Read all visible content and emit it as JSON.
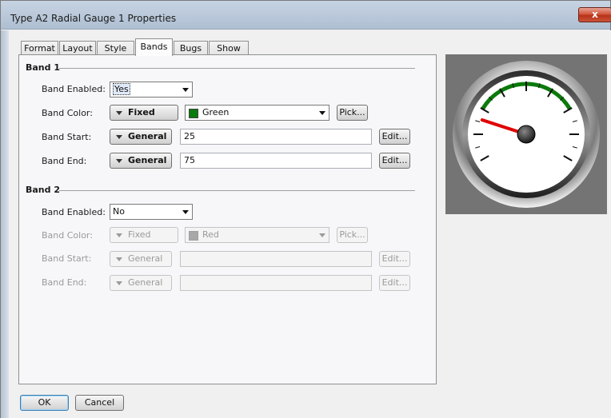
{
  "window": {
    "title": "Type A2 Radial Gauge 1 Properties",
    "close_glyph": "x"
  },
  "tabs": [
    {
      "label": "Format"
    },
    {
      "label": "Layout"
    },
    {
      "label": "Style"
    },
    {
      "label": "Bands",
      "active": true
    },
    {
      "label": "Bugs"
    },
    {
      "label": "Show"
    }
  ],
  "band1": {
    "header": "Band 1",
    "enabled_label": "Band Enabled:",
    "enabled_value": "Yes",
    "color_label": "Band Color:",
    "color_mode": "Fixed",
    "color_value": "Green",
    "color_swatch": "#0a7a0a",
    "pick_label": "Pick...",
    "start_label": "Band Start:",
    "start_mode": "General",
    "start_value": "25",
    "end_label": "Band End:",
    "end_mode": "General",
    "end_value": "75",
    "edit_label": "Edit..."
  },
  "band2": {
    "header": "Band 2",
    "enabled_label": "Band Enabled:",
    "enabled_value": "No",
    "color_label": "Band Color:",
    "color_mode": "Fixed",
    "color_value": "Red",
    "color_swatch": "#a8a8a8",
    "pick_label": "Pick...",
    "start_label": "Band Start:",
    "start_mode": "General",
    "start_value": "",
    "end_label": "Band End:",
    "end_mode": "General",
    "end_value": "",
    "edit_label": "Edit..."
  },
  "gauge": {
    "band_color": "#0a7a0a",
    "needle_color": "#e00000",
    "value": 0.2
  },
  "buttons": {
    "ok": "OK",
    "cancel": "Cancel"
  }
}
